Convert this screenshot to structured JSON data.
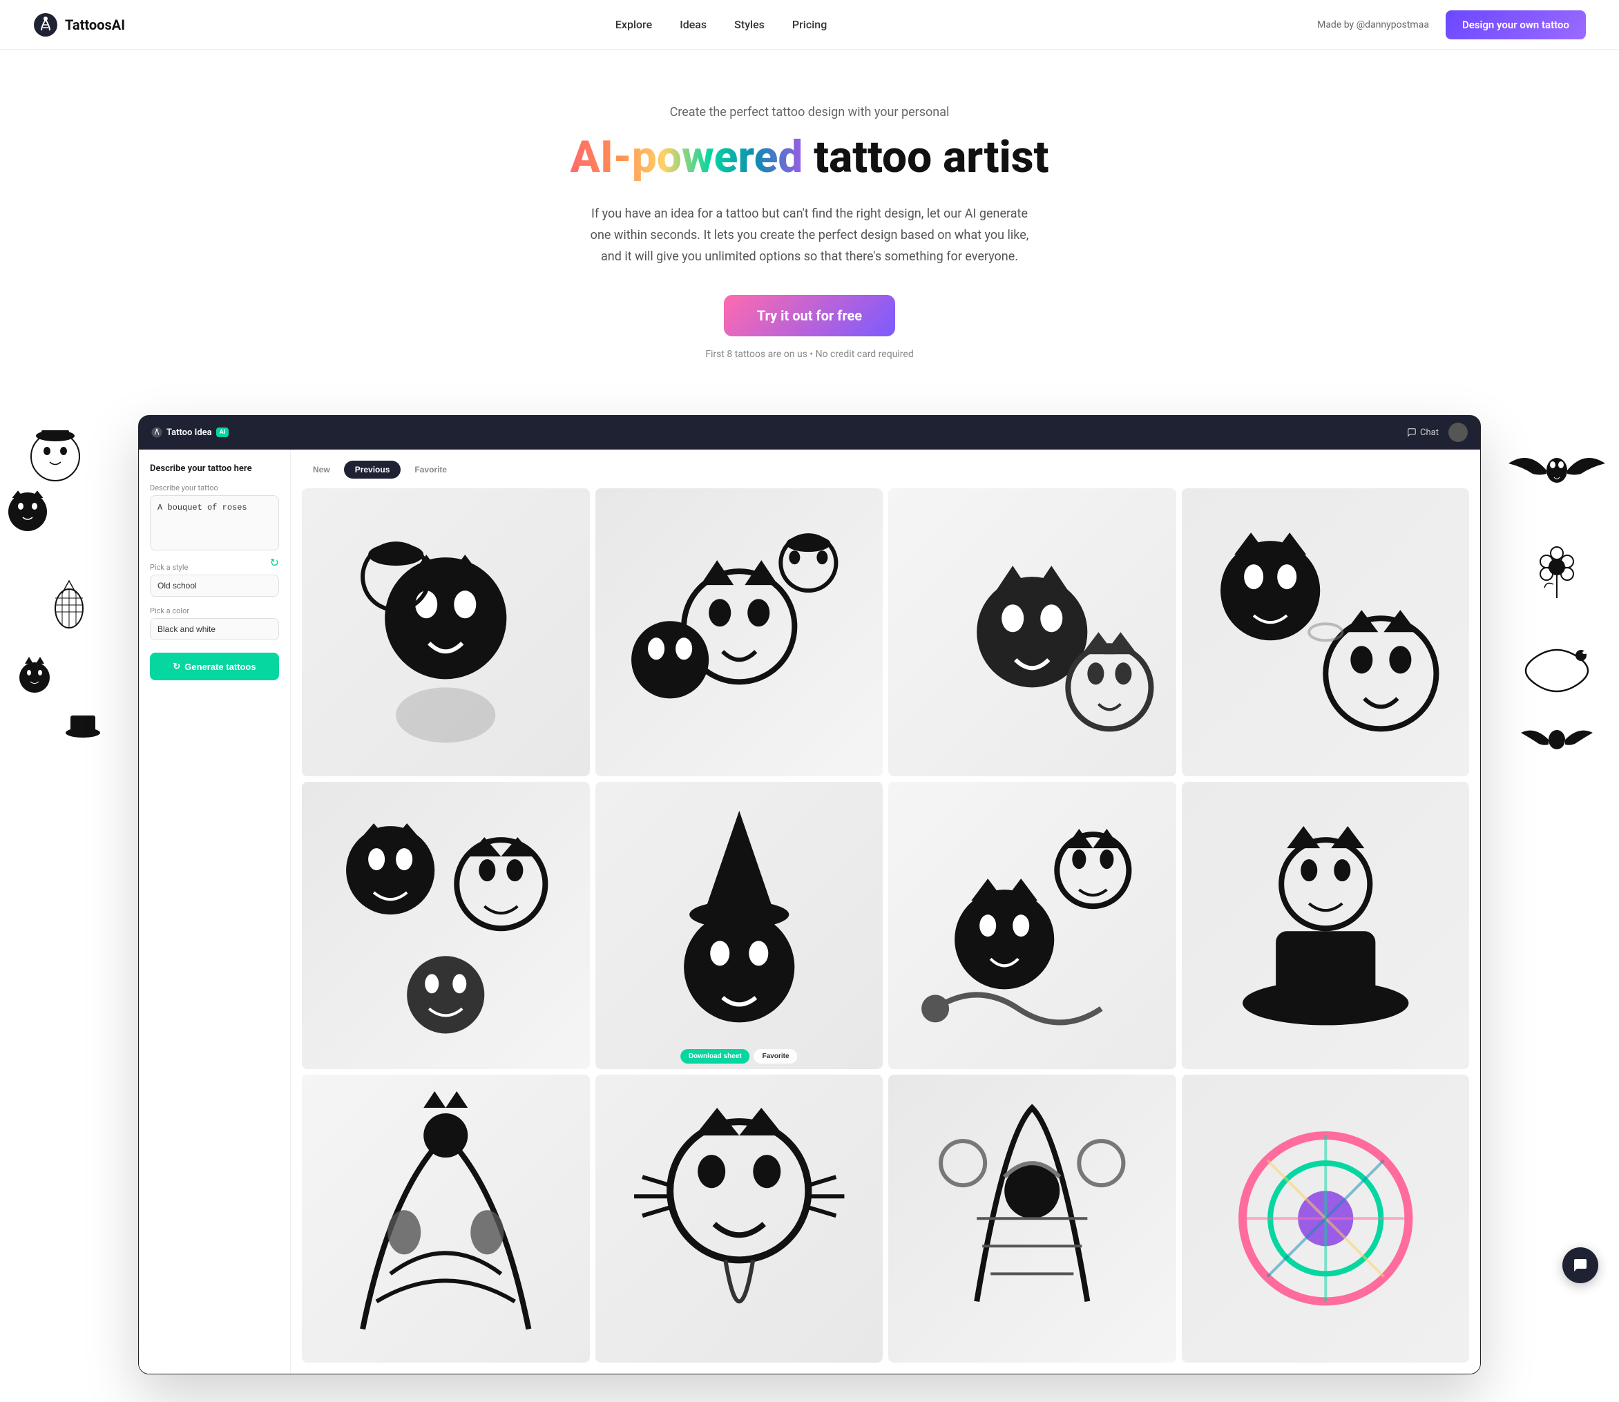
{
  "nav": {
    "logo_text": "TattoosAI",
    "links": [
      {
        "label": "Explore",
        "href": "#"
      },
      {
        "label": "Ideas",
        "href": "#"
      },
      {
        "label": "Styles",
        "href": "#"
      },
      {
        "label": "Pricing",
        "href": "#"
      }
    ],
    "made_by": "Made by @dannypostmaa",
    "cta_label": "Design your own tattoo"
  },
  "hero": {
    "subtitle": "Create the perfect tattoo design with your personal",
    "title_plain": " tattoo artist",
    "title_gradient": "AI-powered",
    "description": "If you have an idea for a tattoo but can't find the right design, let our AI generate one within seconds. It lets you create the perfect design based on what you like, and it will give you unlimited options so that there's something for everyone.",
    "btn_label": "Try it out for free",
    "note": "First 8 tattoos are on us • No credit card required"
  },
  "app": {
    "bar": {
      "title": "Tattoo Idea",
      "badge": "AI",
      "chat_label": "Chat"
    },
    "sidebar": {
      "section_title": "Describe your tattoo here",
      "describe_label": "Describe your tattoo",
      "describe_value": "A bouquet of roses",
      "style_label": "Pick a style",
      "style_value": "Old school",
      "color_label": "Pick a color",
      "color_value": "Black and white",
      "generate_btn": "Generate tattoos",
      "generate_icon": "↻"
    },
    "tabs": [
      {
        "label": "New",
        "active": false
      },
      {
        "label": "Previous",
        "active": true
      },
      {
        "label": "Favorite",
        "active": false
      }
    ],
    "grid": {
      "overlay": {
        "download_label": "Download sheet",
        "favorite_label": "Favorite"
      }
    }
  },
  "chat_btn": {
    "aria": "Open chat"
  }
}
